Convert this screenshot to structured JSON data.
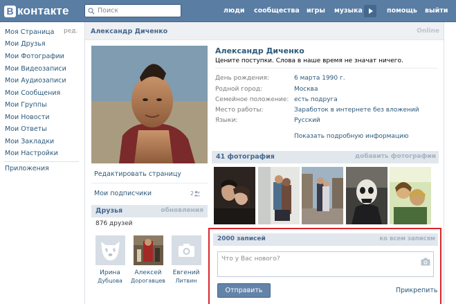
{
  "header": {
    "logo_letter": "В",
    "logo_text": "контакте",
    "search_placeholder": "Поиск",
    "nav": [
      "люди",
      "сообщества",
      "игры",
      "музыка",
      "помощь",
      "выйти"
    ]
  },
  "sidebar": {
    "edit_label": "ред.",
    "items": [
      "Моя Страница",
      "Мои Друзья",
      "Мои Фотографии",
      "Мои Видеозаписи",
      "Мои Аудиозаписи",
      "Мои Сообщения",
      "Мои Группы",
      "Мои Новости",
      "Мои Ответы",
      "Мои Закладки",
      "Мои Настройки"
    ],
    "apps": "Приложения"
  },
  "profile": {
    "header_name": "Александр Диченко",
    "online": "Online",
    "name": "Александр Диченко",
    "status": "Цените поступки. Слова в наше время не значат ничего.",
    "info": [
      {
        "label": "День рождения:",
        "value": "6 марта 1990 г."
      },
      {
        "label": "Родной город:",
        "value": "Москва"
      },
      {
        "label": "Семейное положение:",
        "value": "есть подруга"
      },
      {
        "label": "Место работы:",
        "value": "Заработок в интернете без вложений"
      },
      {
        "label": "Языки:",
        "value": "Русский"
      }
    ],
    "show_more": "Показать подробную информацию"
  },
  "left_column": {
    "edit_page": "Редактировать страницу",
    "subscribers": "Мои подписчики",
    "subscribers_count": "2",
    "friends_title": "Друзья",
    "friends_updates": "обновления",
    "friends_count": "876 друзей",
    "friends": [
      {
        "first": "Ирина",
        "last": "Дубцова"
      },
      {
        "first": "Алексей",
        "last": "Дорогавцев"
      },
      {
        "first": "Евгений",
        "last": "Литвин"
      }
    ]
  },
  "photos": {
    "title": "41 фотография",
    "add": "добавить фотографии"
  },
  "wall": {
    "title": "2000 записей",
    "all": "ко всем записям",
    "placeholder": "Что у Вас нового?",
    "send": "Отправить",
    "attach": "Прикрепить"
  },
  "colors": {
    "header_bg": "#597da3",
    "link": "#2b587a",
    "block_head": "#e1e7ed",
    "highlight_border": "#d9242b",
    "button": "#6383a8"
  }
}
